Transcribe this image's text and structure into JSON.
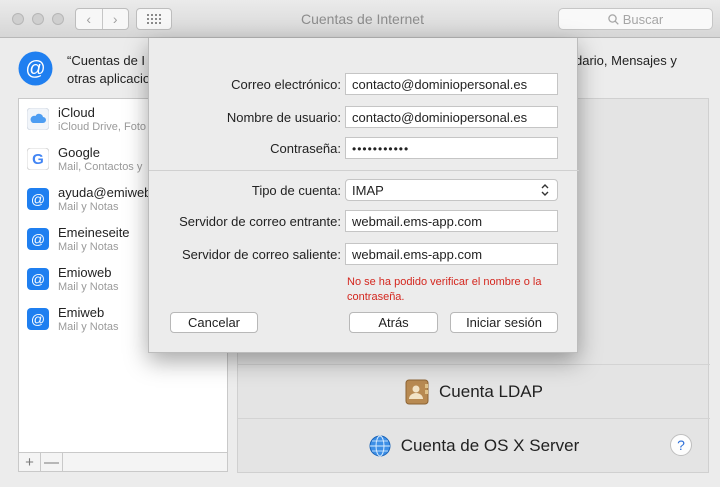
{
  "window": {
    "title": "Cuentas de Internet",
    "search_placeholder": "Buscar",
    "back_glyph": "‹",
    "forward_glyph": "›"
  },
  "header": {
    "text_left": "“Cuentas de I",
    "text_right": "dario, Mensajes y",
    "text_line2": "otras aplicacio"
  },
  "accounts": [
    {
      "name": "iCloud",
      "detail": "iCloud Drive, Foto",
      "icon": "icloud-icon"
    },
    {
      "name": "Google",
      "detail": "Mail, Contactos y",
      "icon": "google-icon"
    },
    {
      "name": "ayuda@emiweb",
      "detail": "Mail y Notas",
      "icon": "at-icon"
    },
    {
      "name": "Emeineseite",
      "detail": "Mail y Notas",
      "icon": "at-icon"
    },
    {
      "name": "Emioweb",
      "detail": "Mail y Notas",
      "icon": "at-icon"
    },
    {
      "name": "Emiweb",
      "detail": "Mail y Notas",
      "icon": "at-icon"
    }
  ],
  "list_footer": {
    "add": "+",
    "remove": "—"
  },
  "providers": {
    "ldap": "Cuenta LDAP",
    "osx_server": "Cuenta de OS X Server"
  },
  "help": "?",
  "sheet": {
    "email_label": "Correo electrónico:",
    "email_value": "contacto@dominiopersonal.es",
    "username_label": "Nombre de usuario:",
    "username_value": "contacto@dominiopersonal.es",
    "password_label": "Contraseña:",
    "password_value": "•••••••••••",
    "account_type_label": "Tipo de cuenta:",
    "account_type_value": "IMAP",
    "incoming_label": "Servidor de correo entrante:",
    "incoming_value": "webmail.ems-app.com",
    "outgoing_label": "Servidor de correo saliente:",
    "outgoing_value": "webmail.ems-app.com",
    "error": "No se ha podido verificar el nombre o la contraseña.",
    "cancel": "Cancelar",
    "back": "Atrás",
    "signin": "Iniciar sesión"
  },
  "colors": {
    "accent": "#1f7ff0",
    "error": "#d4271f"
  }
}
